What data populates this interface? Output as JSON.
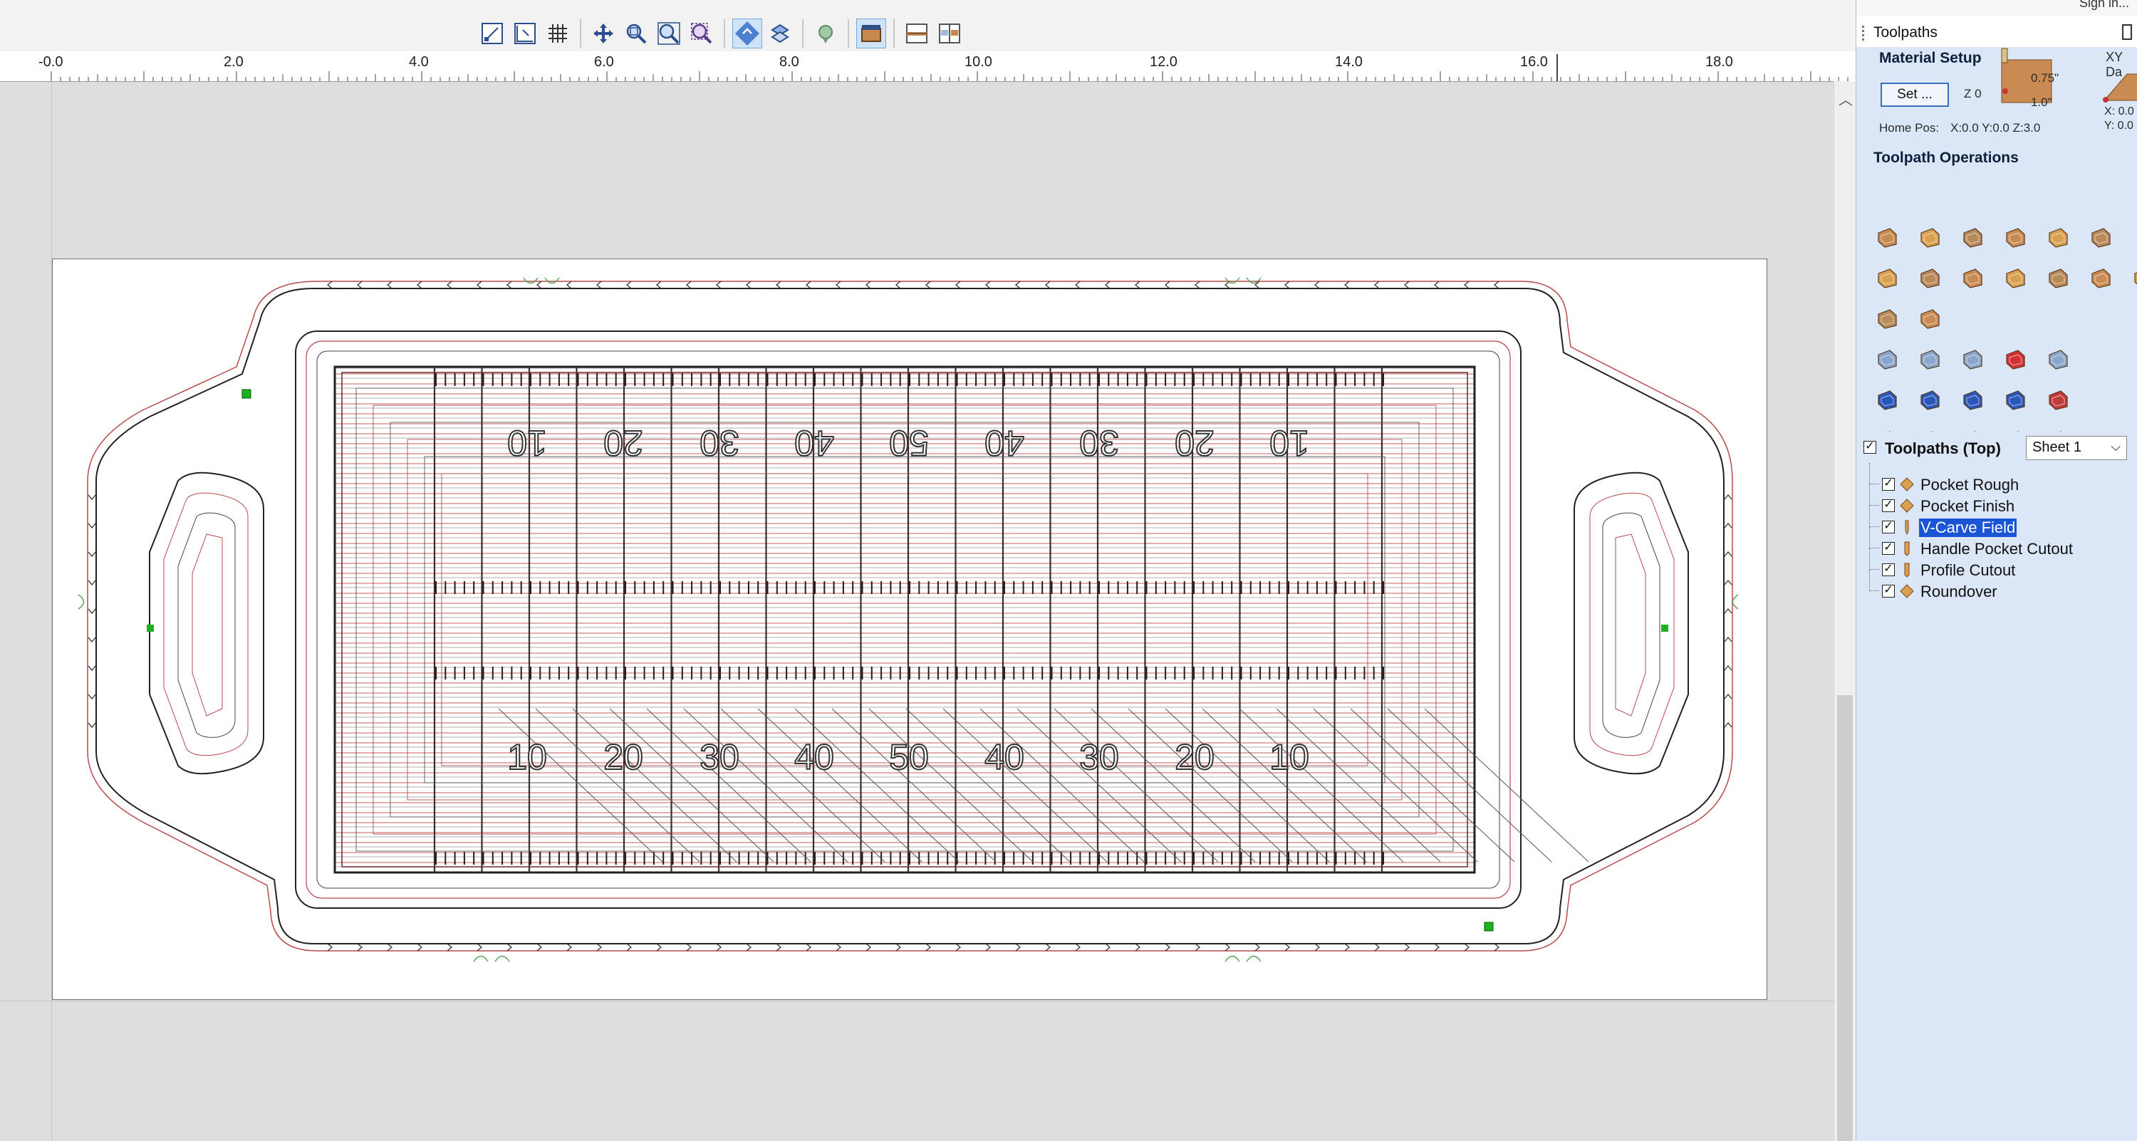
{
  "toolbar": {
    "buttons": [
      {
        "name": "draw-selection-icon"
      },
      {
        "name": "edit-rulers-icon"
      },
      {
        "name": "grid-icon"
      },
      {
        "name": "pan-icon"
      },
      {
        "name": "zoom-box-icon"
      },
      {
        "name": "zoom-extents-icon"
      },
      {
        "name": "zoom-selection-icon"
      },
      {
        "name": "snap-icon"
      },
      {
        "name": "transform-icon"
      },
      {
        "name": "toolpath-preview-icon"
      },
      {
        "name": "material-view-icon"
      },
      {
        "name": "layer-view-icon"
      },
      {
        "name": "split-view-icon"
      }
    ]
  },
  "ruler": {
    "labels": [
      "-0.0",
      "2.0",
      "4.0",
      "6.0",
      "8.0",
      "10.0",
      "12.0",
      "14.0",
      "16.0",
      "18.0"
    ]
  },
  "panel": {
    "signin": "Sign in...",
    "title": "Toolpaths",
    "material_setup": {
      "label": "Material Setup",
      "set_button": "Set ...",
      "z_label": "Z 0",
      "thickness_top": "0.75\"",
      "thickness_bottom": "1.0\"",
      "home_pos_label": "Home Pos:",
      "home_pos_value": "X:0.0 Y:0.0 Z:3.0",
      "xy_datum_label": "XY Da",
      "xy_x": "X: 0.0",
      "xy_y": "Y: 0.0"
    },
    "operations_label": "Toolpath Operations",
    "tree": {
      "header": "Toolpaths (Top)",
      "sheet_selected": "Sheet 1",
      "items": [
        {
          "label": "Pocket Rough",
          "checked": "✓"
        },
        {
          "label": "Pocket Finish",
          "checked": "✓"
        },
        {
          "label": "V-Carve Field",
          "checked": "✓"
        },
        {
          "label": "Handle Pocket Cutout",
          "checked": "✓"
        },
        {
          "label": "Profile Cutout",
          "checked": "✓"
        },
        {
          "label": "Roundover",
          "checked": "✓"
        }
      ]
    }
  },
  "field": {
    "top_numbers": [
      "10",
      "20",
      "30",
      "40",
      "50",
      "40",
      "30",
      "20",
      "10"
    ],
    "bottom_numbers": [
      "10",
      "20",
      "30",
      "40",
      "50",
      "40",
      "30",
      "20",
      "10"
    ]
  }
}
